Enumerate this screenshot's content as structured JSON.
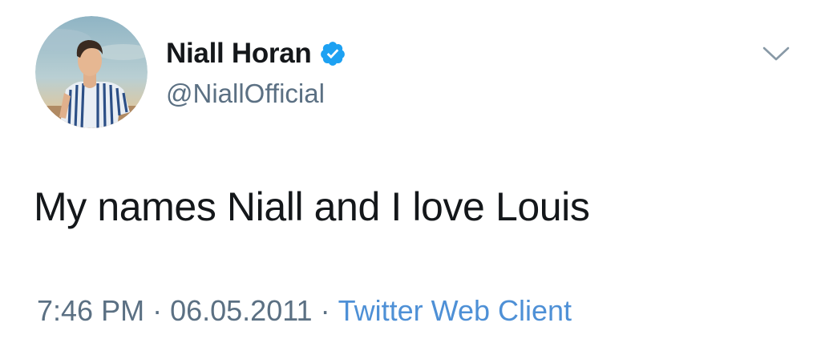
{
  "tweet": {
    "author": {
      "display_name": "Niall Horan",
      "handle": "@NiallOfficial",
      "verified": true,
      "avatar_icon": "profile-photo"
    },
    "text": "My names Niall and I love Louis",
    "meta": {
      "time": "7:46 PM",
      "separator": "·",
      "date": "06.05.2011",
      "source": "Twitter Web Client"
    },
    "menu_icon": "chevron-down-icon"
  },
  "colors": {
    "text_primary": "#14171a",
    "text_secondary": "#5b7083",
    "link": "#4e90d6",
    "verified_badge": "#1da1f2",
    "background": "#ffffff"
  }
}
